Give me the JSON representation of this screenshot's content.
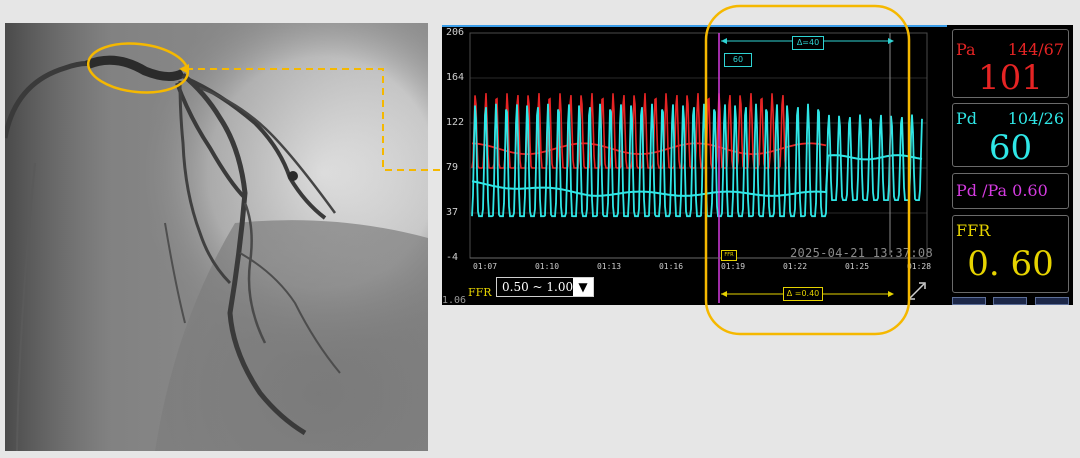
{
  "monitor": {
    "y_ticks": [
      "206",
      "164",
      "122",
      "79",
      "37",
      "-4"
    ],
    "x_ticks": [
      "01:07",
      "01:10",
      "01:13",
      "01:16",
      "01:19",
      "01:22",
      "01:25",
      "01:28"
    ],
    "timestamp": "2025-04-21 13:37:08",
    "delta_time": "Δ=40",
    "cursor_value": "60",
    "ffr_marker": "FFR",
    "ffr_range_label": "FFR",
    "ffr_range_value": "0.50 ~ 1.00",
    "ffr_range_arrow": "▼",
    "bottom_axis_label": "1.06",
    "delta_ffr": "Δ =0.40"
  },
  "panels": {
    "pa": {
      "label": "Pa",
      "systolic_diastolic": "144/67",
      "mean": "101"
    },
    "pd": {
      "label": "Pd",
      "systolic_diastolic": "104/26",
      "mean": "60"
    },
    "ratio": {
      "label": "Pd /Pa 0.60"
    },
    "ffr": {
      "label": "FFR",
      "value": "0. 60"
    }
  },
  "colors": {
    "pa": "#e52424",
    "pd": "#2fe6e6",
    "ratio": "#d43be0",
    "ffr": "#e6d300",
    "annotation": "#f5b800"
  }
}
